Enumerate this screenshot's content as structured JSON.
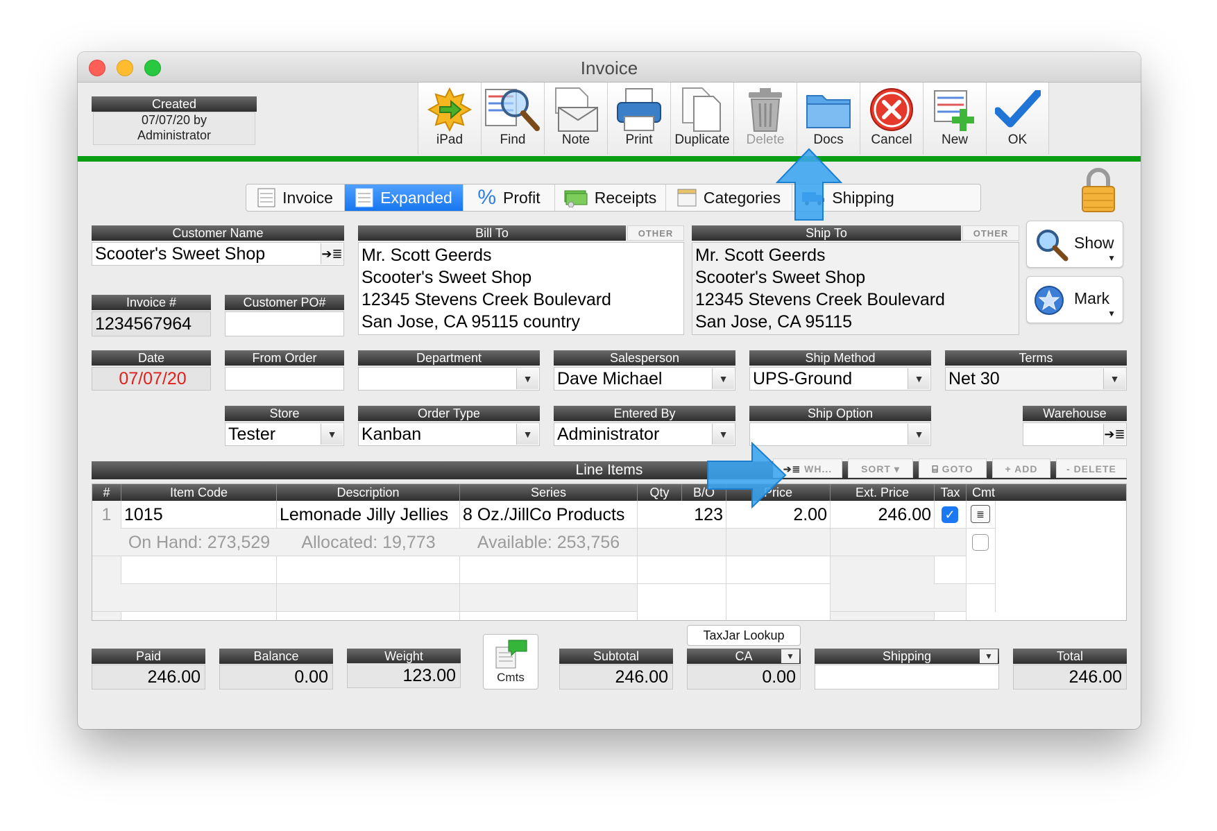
{
  "window": {
    "title": "Invoice"
  },
  "created": {
    "label": "Created",
    "line1": "07/07/20 by",
    "line2": "Administrator"
  },
  "toolbar": [
    {
      "label": "iPad",
      "icon": "ipad-icon"
    },
    {
      "label": "Find",
      "icon": "find-icon"
    },
    {
      "label": "Note",
      "icon": "note-icon"
    },
    {
      "label": "Print",
      "icon": "print-icon"
    },
    {
      "label": "Duplicate",
      "icon": "duplicate-icon"
    },
    {
      "label": "Delete",
      "icon": "trash-icon",
      "disabled": true
    },
    {
      "label": "Docs",
      "icon": "folder-icon"
    },
    {
      "label": "Cancel",
      "icon": "cancel-icon"
    },
    {
      "label": "New",
      "icon": "new-icon"
    },
    {
      "label": "OK",
      "icon": "checkmark-icon"
    }
  ],
  "tabs": [
    {
      "label": "Invoice"
    },
    {
      "label": "Expanded",
      "active": true
    },
    {
      "label": "Profit"
    },
    {
      "label": "Receipts"
    },
    {
      "label": "Categories"
    },
    {
      "label": "Shipping"
    }
  ],
  "side_buttons": {
    "show": "Show",
    "mark": "Mark"
  },
  "customer": {
    "label": "Customer Name",
    "value": "Scooter's Sweet Shop"
  },
  "invoice_no": {
    "label": "Invoice #",
    "value": "1234567964"
  },
  "customer_po": {
    "label": "Customer PO#",
    "value": ""
  },
  "bill_to": {
    "label": "Bill To",
    "other": "OTHER",
    "lines": [
      "Mr. Scott Geerds",
      "Scooter's Sweet Shop",
      "12345 Stevens Creek Boulevard",
      "San Jose, CA  95115  country"
    ]
  },
  "ship_to": {
    "label": "Ship To",
    "other": "OTHER",
    "lines": [
      "Mr. Scott Geerds",
      "Scooter's Sweet Shop",
      "12345 Stevens Creek Boulevard",
      "San Jose, CA  95115"
    ]
  },
  "date": {
    "label": "Date",
    "value": "07/07/20",
    "color": "#e0201b"
  },
  "from_order": {
    "label": "From Order",
    "value": ""
  },
  "department": {
    "label": "Department",
    "value": ""
  },
  "salesperson": {
    "label": "Salesperson",
    "value": "Dave Michael"
  },
  "ship_method": {
    "label": "Ship Method",
    "value": "UPS-Ground"
  },
  "terms": {
    "label": "Terms",
    "value": "Net 30"
  },
  "store": {
    "label": "Store",
    "value": "Tester"
  },
  "order_type": {
    "label": "Order Type",
    "value": "Kanban"
  },
  "entered_by": {
    "label": "Entered By",
    "value": "Administrator"
  },
  "ship_option": {
    "label": "Ship Option",
    "value": ""
  },
  "warehouse": {
    "label": "Warehouse",
    "value": ""
  },
  "line_items": {
    "title": "Line Items",
    "actions": {
      "wh": "WH...",
      "sort": "SORT",
      "goto": "GOTO",
      "add": "+ ADD",
      "delete": "- DELETE"
    },
    "columns": [
      "#",
      "Item Code",
      "Description",
      "Series",
      "Qty",
      "B/O",
      "Price",
      "Ext. Price",
      "Tax",
      "Cmt"
    ],
    "row": {
      "num": "1",
      "item_code": "1015",
      "description": "Lemonade Jilly Jellies",
      "series": "8 Oz./JillCo Products",
      "bo": "123",
      "price": "2.00",
      "ext_price": "246.00",
      "tax": true
    },
    "stock": {
      "on_hand": "On Hand: 273,529",
      "allocated": "Allocated: 19,773",
      "available": "Available: 253,756"
    }
  },
  "footer": {
    "paid": {
      "label": "Paid",
      "value": "246.00"
    },
    "balance": {
      "label": "Balance",
      "value": "0.00"
    },
    "weight": {
      "label": "Weight",
      "value": "123.00"
    },
    "cmts": "Cmts",
    "subtotal": {
      "label": "Subtotal",
      "value": "246.00"
    },
    "taxjar": "TaxJar Lookup",
    "tax": {
      "label": "CA",
      "value": "0.00"
    },
    "shipping": {
      "label": "Shipping",
      "value": ""
    },
    "total": {
      "label": "Total",
      "value": "246.00"
    }
  },
  "colors": {
    "accent_green": "#0a9e14",
    "tab_active": "#1a78f2",
    "callout_blue": "#3aa5f0",
    "date_red": "#e0201b"
  }
}
